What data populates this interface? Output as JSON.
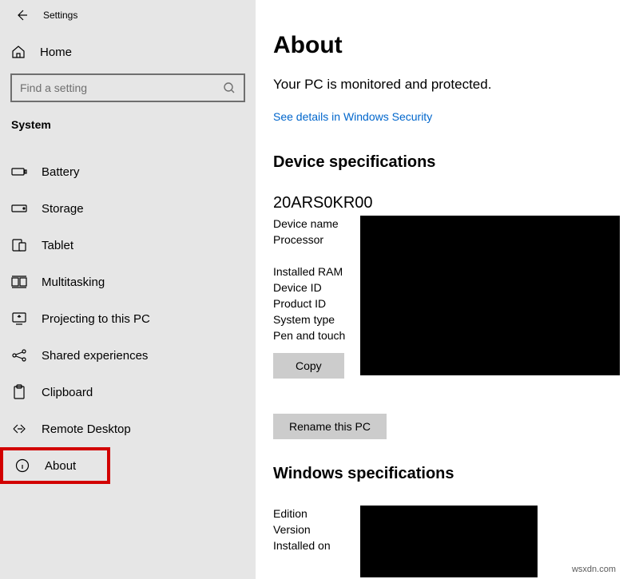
{
  "app": {
    "title": "Settings"
  },
  "sidebar": {
    "home": "Home",
    "search_placeholder": "Find a setting",
    "section": "System",
    "items": [
      {
        "label": "Battery"
      },
      {
        "label": "Storage"
      },
      {
        "label": "Tablet"
      },
      {
        "label": "Multitasking"
      },
      {
        "label": "Projecting to this PC"
      },
      {
        "label": "Shared experiences"
      },
      {
        "label": "Clipboard"
      },
      {
        "label": "Remote Desktop"
      },
      {
        "label": "About"
      }
    ]
  },
  "content": {
    "title": "About",
    "subtitle": "Your PC is monitored and protected.",
    "security_link": "See details in Windows Security",
    "device_spec_heading": "Device specifications",
    "device_model": "20ARS0KR00",
    "device_labels": [
      "Device name",
      "Processor",
      "",
      "Installed RAM",
      "Device ID",
      "Product ID",
      "System type",
      "Pen and touch"
    ],
    "copy_btn": "Copy",
    "rename_btn": "Rename this PC",
    "win_spec_heading": "Windows specifications",
    "win_labels": [
      "Edition",
      "Version",
      "Installed on"
    ]
  },
  "watermark": "wsxdn.com"
}
